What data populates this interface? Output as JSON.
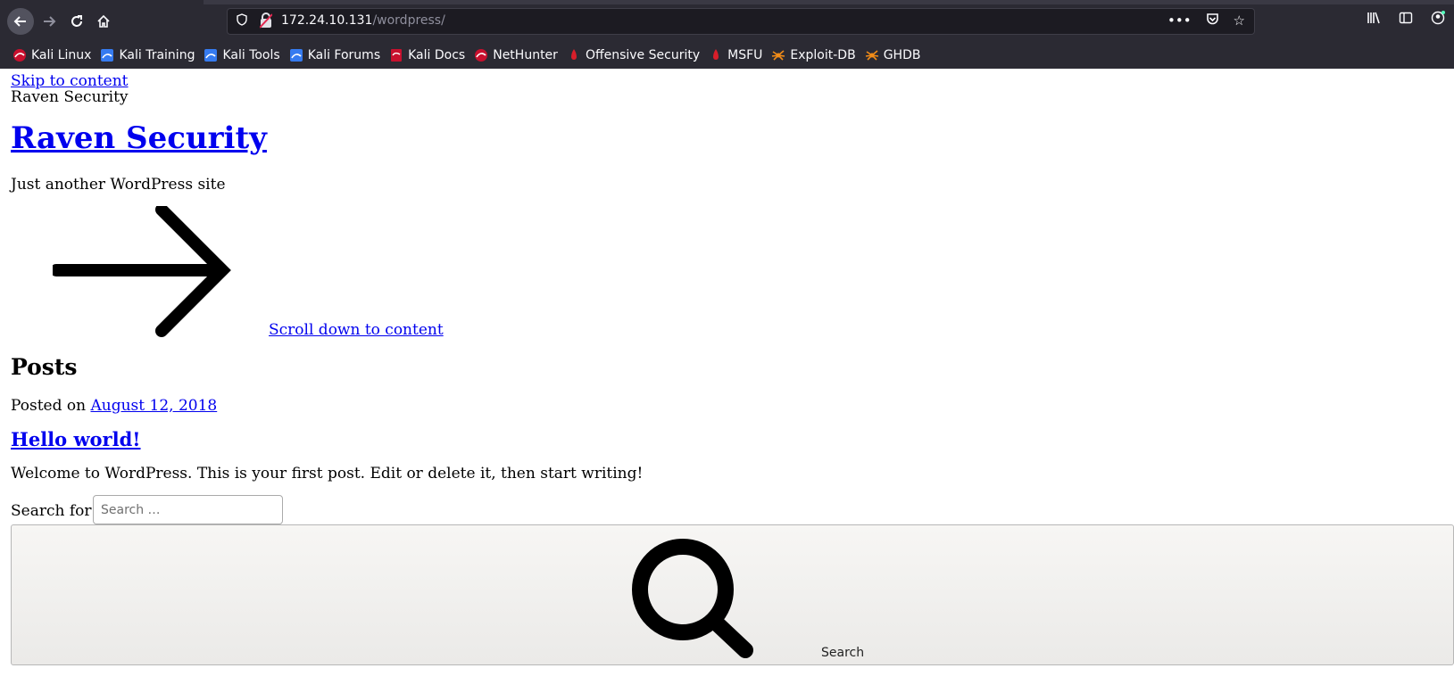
{
  "browser": {
    "url_host": "172.24.10.131",
    "url_path": "/wordpress/",
    "nav": {
      "back_icon": "arrow-left-icon",
      "forward_icon": "arrow-right-icon",
      "reload_icon": "reload-icon",
      "home_icon": "home-icon"
    },
    "urlbar_icons": [
      "shield-icon",
      "insecure-lock-icon",
      "more-icon",
      "pocket-icon",
      "star-icon"
    ],
    "toolbar_icons": [
      "library-icon",
      "sidebar-icon",
      "account-icon"
    ],
    "bookmarks": [
      {
        "label": "Kali Linux",
        "icon": "kali-icon"
      },
      {
        "label": "Kali Training",
        "icon": "kali-blue-icon"
      },
      {
        "label": "Kali Tools",
        "icon": "kali-blue-icon"
      },
      {
        "label": "Kali Forums",
        "icon": "kali-blue-icon"
      },
      {
        "label": "Kali Docs",
        "icon": "kali-docs-icon"
      },
      {
        "label": "NetHunter",
        "icon": "kali-icon"
      },
      {
        "label": "Offensive Security",
        "icon": "offsec-icon"
      },
      {
        "label": "MSFU",
        "icon": "offsec-icon"
      },
      {
        "label": "Exploit-DB",
        "icon": "exploitdb-icon"
      },
      {
        "label": "GHDB",
        "icon": "exploitdb-icon"
      }
    ]
  },
  "page": {
    "skip_link": "Skip to content",
    "site_name": "Raven Security",
    "site_title": "Raven Security",
    "tagline": "Just another WordPress site",
    "scroll_link": "Scroll down to content",
    "posts_heading": "Posts",
    "posted_on": "Posted on",
    "post_date": "August 12, 2018",
    "post_title": "Hello world!",
    "excerpt": "Welcome to WordPress. This is your first post. Edit or delete it, then start writing!",
    "search_label": "Search for:",
    "search_placeholder": "Search …",
    "search_button": "Search"
  }
}
